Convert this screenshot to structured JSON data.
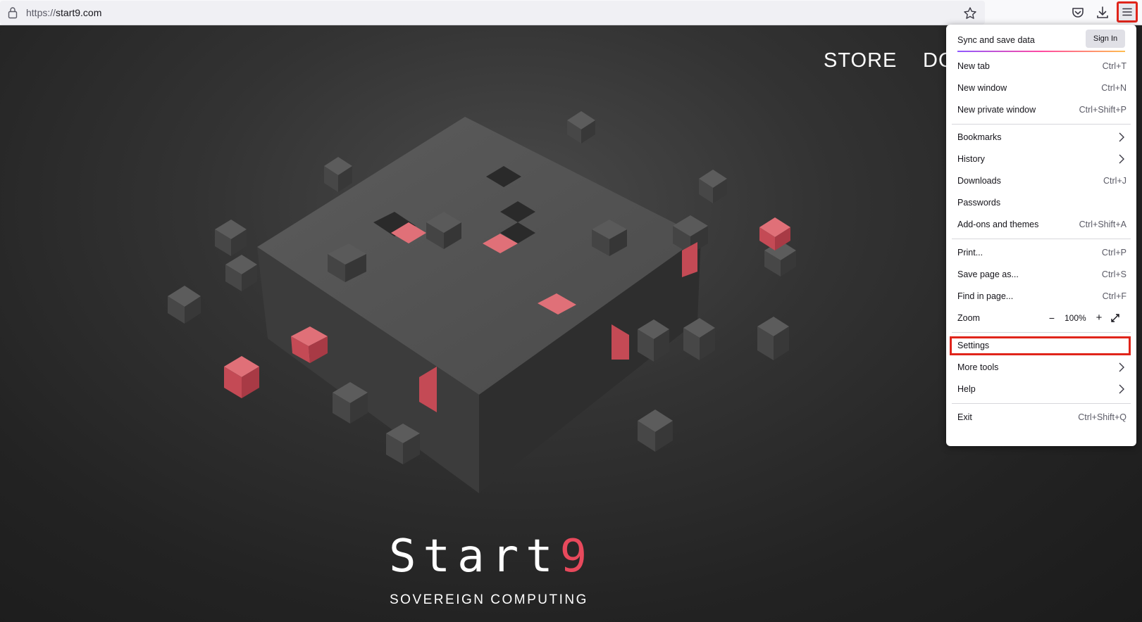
{
  "browser": {
    "url_scheme": "https://",
    "url_host": "start9.com",
    "icons": [
      "lock-icon",
      "star-icon",
      "pocket-icon",
      "download-icon",
      "hamburger-menu-icon"
    ]
  },
  "page": {
    "nav": {
      "store": "STORE",
      "docs": "DO"
    },
    "brand_main": "Start",
    "brand_accent": "9",
    "tagline": "SOVEREIGN COMPUTING",
    "accent_color": "#e8495c"
  },
  "menu": {
    "sync_label": "Sync and save data",
    "sign_in": "Sign In",
    "new_tab": {
      "label": "New tab",
      "shortcut": "Ctrl+T"
    },
    "new_window": {
      "label": "New window",
      "shortcut": "Ctrl+N"
    },
    "new_private_window": {
      "label": "New private window",
      "shortcut": "Ctrl+Shift+P"
    },
    "bookmarks": {
      "label": "Bookmarks"
    },
    "history": {
      "label": "History"
    },
    "downloads": {
      "label": "Downloads",
      "shortcut": "Ctrl+J"
    },
    "passwords": {
      "label": "Passwords"
    },
    "addons": {
      "label": "Add-ons and themes",
      "shortcut": "Ctrl+Shift+A"
    },
    "print": {
      "label": "Print...",
      "shortcut": "Ctrl+P"
    },
    "save_page": {
      "label": "Save page as...",
      "shortcut": "Ctrl+S"
    },
    "find": {
      "label": "Find in page...",
      "shortcut": "Ctrl+F"
    },
    "zoom": {
      "label": "Zoom",
      "minus": "−",
      "value": "100%",
      "plus": "+"
    },
    "settings": {
      "label": "Settings"
    },
    "more_tools": {
      "label": "More tools"
    },
    "help": {
      "label": "Help"
    },
    "exit": {
      "label": "Exit",
      "shortcut": "Ctrl+Shift+Q"
    },
    "highlight_color": "#e0251b"
  }
}
